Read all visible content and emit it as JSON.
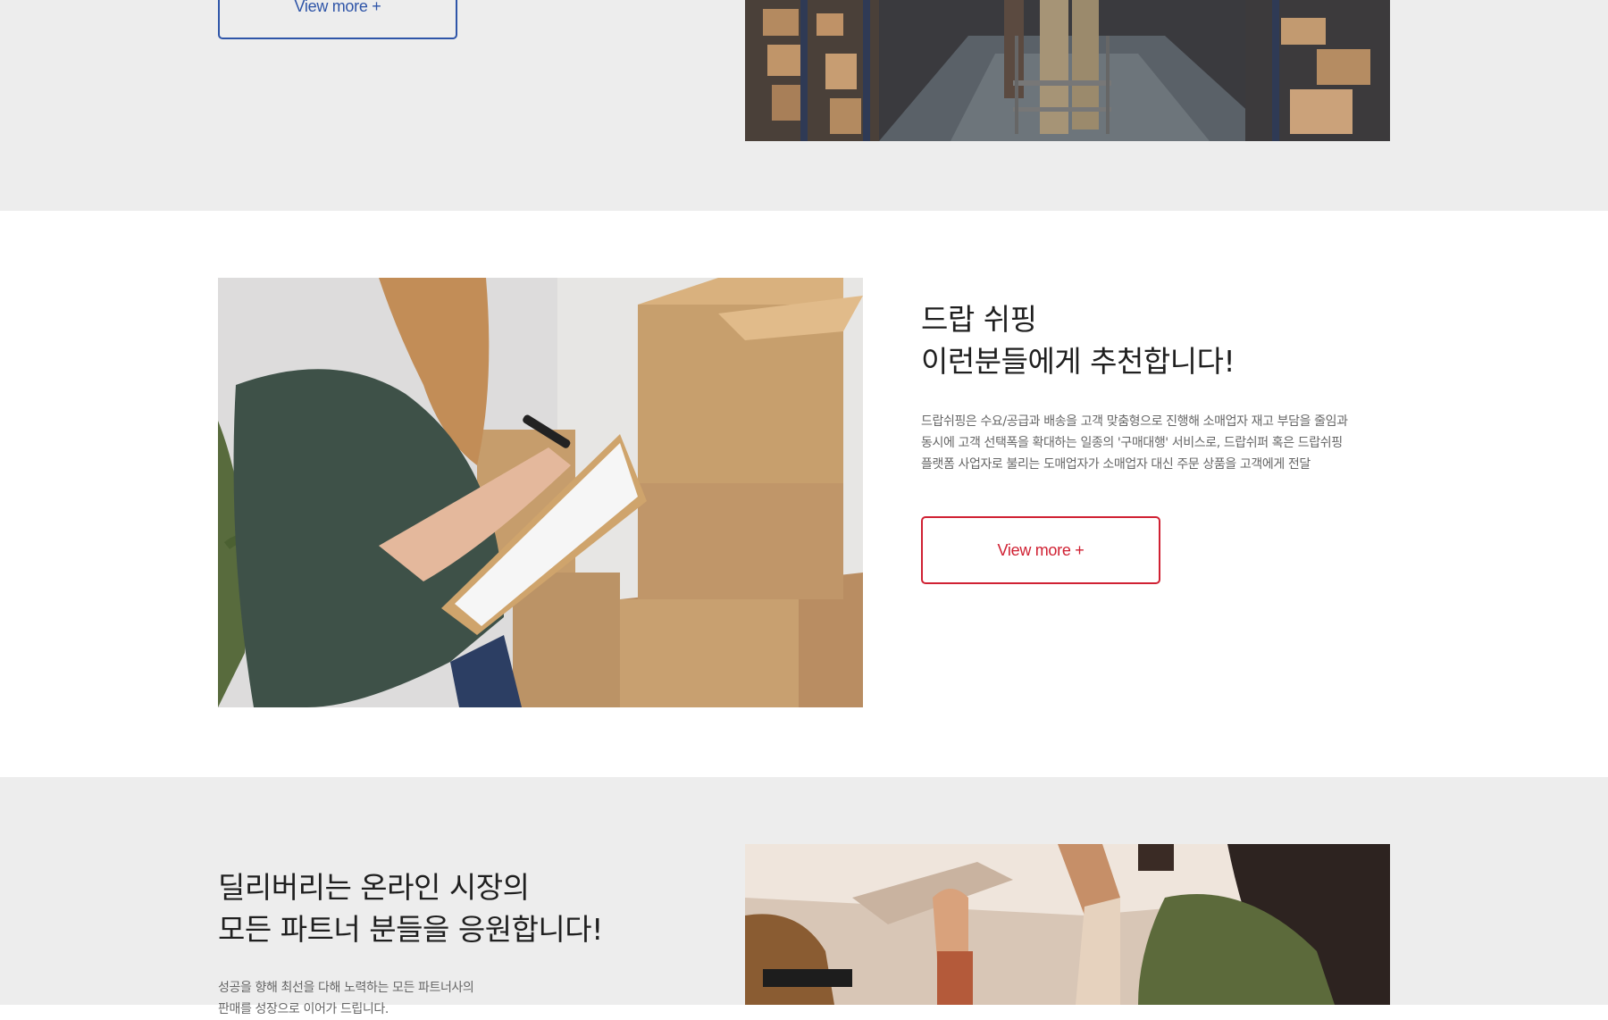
{
  "top_section": {
    "button_label": "View more +"
  },
  "drop_section": {
    "title_line1": "드랍 쉬핑",
    "title_line2": "이런분들에게 추천합니다!",
    "desc_line1": "드랍쉬핑은 수요/공급과 배송을 고객 맞춤형으로 진행해 소매업자 재고 부담을 줄임과",
    "desc_line2": "동시에 고객 선택폭을 확대하는 일종의 '구매대행' 서비스로, 드랍쉬퍼 혹은 드랍쉬핑",
    "desc_line3": "플랫폼 사업자로 불리는 도매업자가 소매업자 대신 주문 상품을 고객에게 전달",
    "button_label": "View more +"
  },
  "partner_section": {
    "title_line1": "딜리버리는 온라인 시장의",
    "title_line2": "모든 파트너 분들을 응원합니다!",
    "desc_line1": "성공을 향해 최선을 다해 노력하는 모든 파트너사의",
    "desc_line2": "판매를 성장으로 이어가 드립니다."
  },
  "colors": {
    "section_gray": "#ededed",
    "accent_blue": "#2f55a8",
    "accent_red": "#d02133"
  }
}
